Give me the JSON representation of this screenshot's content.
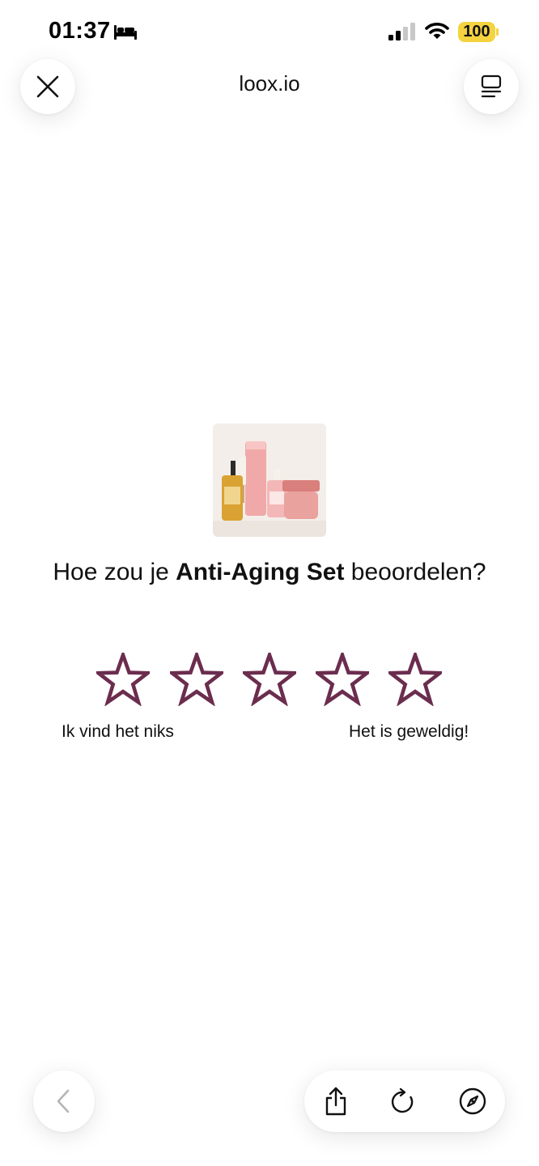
{
  "status_bar": {
    "time": "01:37",
    "battery": "100",
    "icons": [
      "bed-icon",
      "signal-icon",
      "wifi-icon",
      "battery-icon"
    ],
    "battery_color": "#f5d33f"
  },
  "browser": {
    "url": "loox.io",
    "icons": [
      "close-icon",
      "tabs-icon",
      "back-icon",
      "share-icon",
      "reload-icon",
      "compass-icon"
    ]
  },
  "review": {
    "question_prefix": "Hoe zou je ",
    "product_name": "Anti-Aging Set",
    "question_suffix": " beoordelen?",
    "star_count": 5,
    "stars_selected": 0,
    "star_color": "#6b2d4e",
    "label_low": "Ik vind het niks",
    "label_high": "Het is geweldig!"
  }
}
